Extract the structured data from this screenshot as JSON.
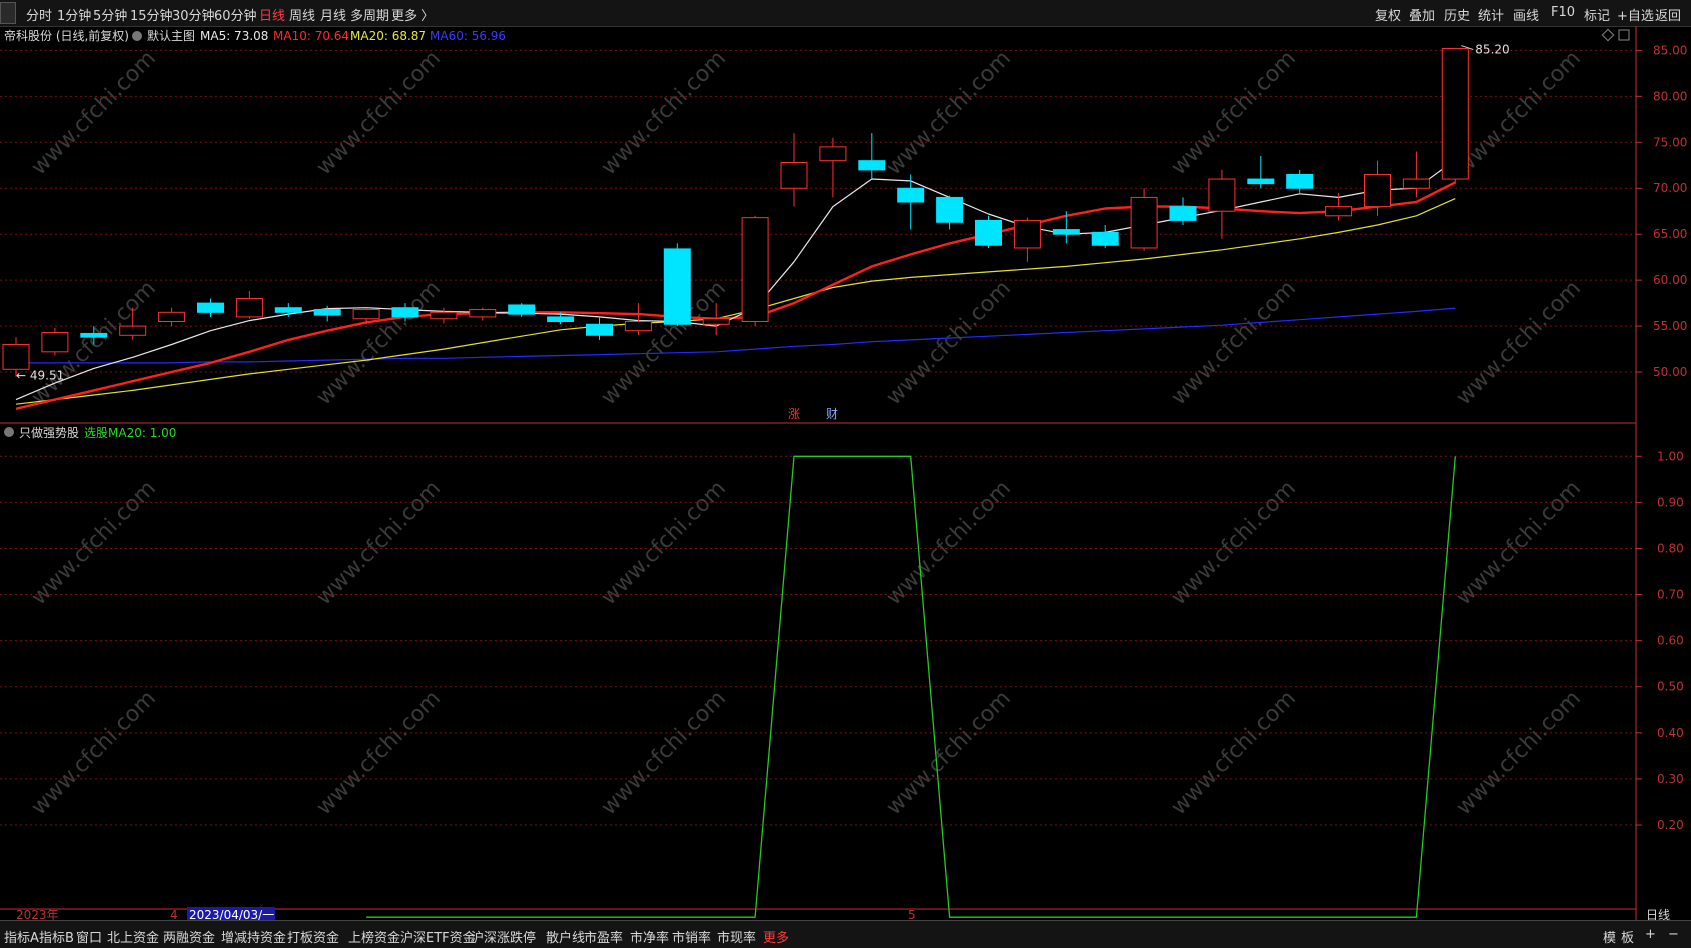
{
  "toolbar": {
    "periods": [
      "分时",
      "1分钟",
      "5分钟",
      "15分钟",
      "30分钟",
      "60分钟",
      "日线",
      "周线",
      "月线",
      "多周期",
      "更多 〉"
    ],
    "active_period": "日线",
    "right_tools": [
      "复权",
      "叠加",
      "历史",
      "统计",
      "画线",
      "F10",
      "标记",
      "+自选",
      "返回"
    ]
  },
  "main_panel": {
    "stock_title": "帝科股份 (日线,前复权)",
    "indicator_name": "默认主图",
    "ma_labels": [
      {
        "text": "MA5: 73.08",
        "color": "#e8e8e8"
      },
      {
        "text": "MA10: 70.64",
        "color": "#ff2a2a"
      },
      {
        "text": "MA20: 68.87",
        "color": "#e8e83a"
      },
      {
        "text": "MA60: 56.96",
        "color": "#3a3aff"
      }
    ],
    "high_label": "85.20",
    "low_label": "49.51",
    "markers": [
      {
        "text": "涨",
        "color": "#ff3030"
      },
      {
        "text": "财",
        "color": "#88aaff"
      }
    ]
  },
  "sub_panel": {
    "indicator_name": "只做强势股",
    "value_label": "选股MA20: 1.00"
  },
  "date_axis": {
    "year_label": "2023年",
    "month_label_1": "4",
    "cursor_date": "2023/04/03/一",
    "month_label_2": "5",
    "right_label": "日线"
  },
  "watermark": "www.cfchi.com",
  "bottom_tabs": [
    "指标A",
    "指标B",
    "窗口",
    "北上资金",
    "两融资金",
    "增减持资金",
    "打板资金",
    "上榜资金",
    "沪深ETF资金",
    "沪深涨跌停",
    "散户线",
    "市盈率",
    "市净率",
    "市销率",
    "市现率",
    "更多"
  ],
  "bottom_right": [
    "模",
    "板",
    "+",
    "−"
  ],
  "colors": {
    "up": "#ff3030",
    "down": "#00e5ff",
    "ma5": "#e8e8e8",
    "ma10": "#ff2020",
    "ma20": "#e0e030",
    "ma60": "#2828ff",
    "signal": "#22cc22",
    "grid": "#7a1010",
    "axis": "#c03030"
  },
  "chart_data": [
    {
      "type": "candlestick",
      "title": "帝科股份 (日线,前复权)",
      "ylim": [
        45,
        87
      ],
      "yticks": [
        50,
        55,
        60,
        65,
        70,
        75,
        80,
        85
      ],
      "candles": [
        {
          "o": 50.3,
          "h": 53.8,
          "l": 49.5,
          "c": 53.0
        },
        {
          "o": 52.2,
          "h": 54.8,
          "l": 51.8,
          "c": 54.3
        },
        {
          "o": 54.2,
          "h": 55.0,
          "l": 53.0,
          "c": 53.8
        },
        {
          "o": 54.0,
          "h": 57.0,
          "l": 53.5,
          "c": 55.0
        },
        {
          "o": 55.5,
          "h": 57.0,
          "l": 55.0,
          "c": 56.5
        },
        {
          "o": 57.5,
          "h": 58.0,
          "l": 56.0,
          "c": 56.5
        },
        {
          "o": 56.0,
          "h": 58.8,
          "l": 55.8,
          "c": 58.0
        },
        {
          "o": 57.0,
          "h": 57.5,
          "l": 56.0,
          "c": 56.5
        },
        {
          "o": 56.8,
          "h": 57.2,
          "l": 55.5,
          "c": 56.2
        },
        {
          "o": 55.8,
          "h": 57.0,
          "l": 55.2,
          "c": 56.8
        },
        {
          "o": 57.0,
          "h": 57.5,
          "l": 55.5,
          "c": 56.0
        },
        {
          "o": 55.8,
          "h": 57.0,
          "l": 55.3,
          "c": 56.5
        },
        {
          "o": 56.0,
          "h": 57.0,
          "l": 55.6,
          "c": 56.8
        },
        {
          "o": 57.3,
          "h": 57.5,
          "l": 56.0,
          "c": 56.3
        },
        {
          "o": 56.0,
          "h": 56.5,
          "l": 55.2,
          "c": 55.5
        },
        {
          "o": 55.2,
          "h": 56.0,
          "l": 53.5,
          "c": 54.0
        },
        {
          "o": 54.5,
          "h": 57.5,
          "l": 54.0,
          "c": 55.5
        },
        {
          "o": 63.4,
          "h": 64.0,
          "l": 55.0,
          "c": 55.2
        },
        {
          "o": 55.2,
          "h": 57.5,
          "l": 54.0,
          "c": 55.8
        },
        {
          "o": 55.5,
          "h": 67.0,
          "l": 55.0,
          "c": 66.8
        },
        {
          "o": 70.0,
          "h": 76.0,
          "l": 68.0,
          "c": 72.8
        },
        {
          "o": 73.0,
          "h": 75.5,
          "l": 69.0,
          "c": 74.5
        },
        {
          "o": 73.0,
          "h": 76.0,
          "l": 71.0,
          "c": 72.0
        },
        {
          "o": 70.0,
          "h": 71.5,
          "l": 65.5,
          "c": 68.5
        },
        {
          "o": 69.0,
          "h": 69.2,
          "l": 65.5,
          "c": 66.3
        },
        {
          "o": 66.5,
          "h": 67.0,
          "l": 63.5,
          "c": 63.8
        },
        {
          "o": 63.5,
          "h": 66.8,
          "l": 62.0,
          "c": 66.5
        },
        {
          "o": 65.5,
          "h": 67.5,
          "l": 64.0,
          "c": 65.0
        },
        {
          "o": 65.2,
          "h": 66.0,
          "l": 63.5,
          "c": 63.8
        },
        {
          "o": 63.5,
          "h": 70.0,
          "l": 63.2,
          "c": 69.0
        },
        {
          "o": 68.0,
          "h": 69.0,
          "l": 66.0,
          "c": 66.5
        },
        {
          "o": 67.5,
          "h": 72.0,
          "l": 64.5,
          "c": 71.0
        },
        {
          "o": 71.0,
          "h": 73.5,
          "l": 70.0,
          "c": 70.5
        },
        {
          "o": 71.5,
          "h": 72.0,
          "l": 69.5,
          "c": 70.0
        },
        {
          "o": 67.0,
          "h": 69.5,
          "l": 66.5,
          "c": 68.0
        },
        {
          "o": 68.0,
          "h": 73.0,
          "l": 67.0,
          "c": 71.5
        },
        {
          "o": 70.0,
          "h": 74.0,
          "l": 69.0,
          "c": 71.0
        },
        {
          "o": 71.0,
          "h": 85.2,
          "l": 70.5,
          "c": 85.2
        }
      ],
      "ma5": [
        47.0,
        48.8,
        50.4,
        51.6,
        53.0,
        54.5,
        55.6,
        56.3,
        56.9,
        57.0,
        56.8,
        56.6,
        56.5,
        56.4,
        56.3,
        56.0,
        55.6,
        55.5,
        55.0,
        57.0,
        62.0,
        68.0,
        71.0,
        70.8,
        69.0,
        67.2,
        65.8,
        65.0,
        65.2,
        66.0,
        66.8,
        67.6,
        68.5,
        69.4,
        69.0,
        69.8,
        70.0,
        73.08
      ],
      "ma10": [
        46.0,
        47.0,
        48.0,
        49.0,
        50.0,
        51.0,
        52.2,
        53.5,
        54.5,
        55.4,
        56.0,
        56.3,
        56.4,
        56.5,
        56.5,
        56.4,
        56.3,
        56.0,
        55.8,
        56.0,
        57.5,
        59.5,
        61.5,
        62.8,
        64.0,
        65.0,
        66.0,
        67.0,
        67.8,
        68.0,
        68.0,
        67.8,
        67.5,
        67.3,
        67.5,
        68.0,
        68.5,
        70.64
      ],
      "ma20": [
        46.5,
        47.0,
        47.5,
        48.0,
        48.6,
        49.2,
        49.8,
        50.3,
        50.8,
        51.3,
        51.9,
        52.5,
        53.2,
        53.9,
        54.6,
        55.0,
        55.3,
        55.5,
        55.8,
        56.8,
        58.0,
        59.2,
        59.9,
        60.3,
        60.6,
        60.9,
        61.2,
        61.5,
        61.9,
        62.3,
        62.8,
        63.3,
        63.9,
        64.5,
        65.2,
        66.0,
        67.0,
        68.87
      ],
      "ma60": [
        51.0,
        51.0,
        51.0,
        51.0,
        51.0,
        51.1,
        51.1,
        51.2,
        51.3,
        51.4,
        51.5,
        51.5,
        51.6,
        51.7,
        51.8,
        51.9,
        52.0,
        52.1,
        52.2,
        52.5,
        52.8,
        53.0,
        53.3,
        53.5,
        53.7,
        53.9,
        54.1,
        54.3,
        54.5,
        54.7,
        54.9,
        55.1,
        55.4,
        55.7,
        56.0,
        56.3,
        56.6,
        56.96
      ]
    },
    {
      "type": "line",
      "title": "只做强势股",
      "series": [
        {
          "name": "选股MA20",
          "values": [
            null,
            null,
            null,
            null,
            null,
            null,
            null,
            null,
            null,
            0,
            0,
            0,
            0,
            0,
            0,
            0,
            0,
            0,
            0,
            0,
            1,
            1,
            1,
            1,
            0,
            0,
            0,
            0,
            0,
            0,
            0,
            0,
            0,
            0,
            0,
            0,
            0,
            1
          ]
        }
      ],
      "ylim": [
        0.02,
        1.07
      ],
      "yticks": [
        0.2,
        0.3,
        0.4,
        0.5,
        0.6,
        0.7,
        0.8,
        0.9,
        1.0
      ]
    }
  ]
}
